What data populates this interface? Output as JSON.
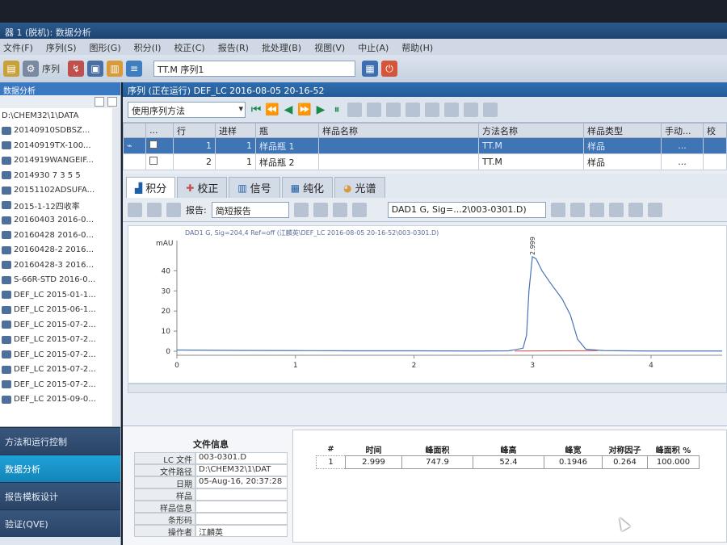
{
  "window": {
    "title": "器 1 (脱机): 数据分析"
  },
  "menu": [
    "文件(F)",
    "序列(S)",
    "图形(G)",
    "积分(I)",
    "校正(C)",
    "报告(R)",
    "批处理(B)",
    "视图(V)",
    "中止(A)",
    "帮助(H)"
  ],
  "toolbar": {
    "run_label": "序列",
    "sequence_value": "TT.M 序列1"
  },
  "left_panel": {
    "header": "数据分析",
    "tree": [
      "D:\\CHEM32\\1\\DATA",
      "20140910SDBSZ...",
      "20140919TX-100...",
      "2014919WANGEIF...",
      "2014930 7 3 5 5",
      "20151102ADSUFA...",
      "2015-1-12四收率",
      "20160403 2016-0...",
      "20160428 2016-0...",
      "20160428-2 2016...",
      "20160428-3 2016...",
      "S-66R-STD 2016-0...",
      "DEF_LC 2015-01-1...",
      "DEF_LC 2015-06-1...",
      "DEF_LC 2015-07-2...",
      "DEF_LC 2015-07-2...",
      "DEF_LC 2015-07-2...",
      "DEF_LC 2015-07-2...",
      "DEF_LC 2015-07-2...",
      "DEF_LC 2015-09-0..."
    ],
    "nav": [
      "方法和运行控制",
      "数据分析",
      "报告模板设计",
      "验证(QVE)"
    ]
  },
  "sequence_bar": "序列 (正在运行) DEF_LC 2016-08-05 20-16-52",
  "method_select": "使用序列方法",
  "sequence_table": {
    "headers": [
      "...",
      "行",
      "进样",
      "瓶",
      "样品名称",
      "方法名称",
      "样品类型",
      "手动...",
      "校"
    ],
    "rows": [
      {
        "row": "1",
        "inj": "1",
        "vial": "样品瓶 1",
        "sample": "",
        "method": "TT.M",
        "type": "样品",
        "manual": "...",
        "calib": ""
      },
      {
        "row": "2",
        "inj": "1",
        "vial": "样品瓶 2",
        "sample": "",
        "method": "TT.M",
        "type": "样品",
        "manual": "...",
        "calib": ""
      }
    ]
  },
  "tabs": [
    "积分",
    "校正",
    "信号",
    "纯化",
    "光谱"
  ],
  "report": {
    "label": "报告:",
    "value": "简短报告",
    "signal": "DAD1 G, Sig=...2\\003-0301.D)"
  },
  "chart_data": {
    "type": "line",
    "title": "DAD1 G, Sig=204,4 Ref=off (江麟英\\DEF_LC 2016-08-05 20-16-52\\003-0301.D)",
    "ylabel": "mAU",
    "xlabel": "",
    "xlim": [
      0,
      4.6
    ],
    "ylim": [
      -2,
      55
    ],
    "xticks": [
      0,
      1,
      2,
      3,
      4
    ],
    "yticks": [
      0,
      10,
      20,
      30,
      40
    ],
    "peak_label": "2.999",
    "series": [
      {
        "color": "#4a73b8",
        "x": [
          0,
          0.5,
          1.0,
          1.5,
          2.0,
          2.5,
          2.8,
          2.92,
          2.95,
          2.97,
          2.999,
          3.03,
          3.08,
          3.15,
          3.25,
          3.32,
          3.38,
          3.45,
          3.6,
          4.0,
          4.6
        ],
        "y": [
          0.6,
          0.4,
          0.3,
          0.2,
          0.2,
          0.1,
          0.2,
          1.5,
          8,
          30,
          47,
          46,
          40,
          34,
          26,
          18,
          6,
          1,
          0.3,
          0.1,
          0.1
        ]
      }
    ],
    "baseline": {
      "color": "#c44",
      "x": [
        2.85,
        3.55
      ],
      "y": [
        0.1,
        0.3
      ]
    }
  },
  "file_info": {
    "title": "文件信息",
    "rows": [
      {
        "key": "LC 文件",
        "value": "003-0301.D"
      },
      {
        "key": "文件路径",
        "value": "D:\\CHEM32\\1\\DAT"
      },
      {
        "key": "日期",
        "value": "05-Aug-16, 20:37:28"
      },
      {
        "key": "样品",
        "value": ""
      },
      {
        "key": "样品信息",
        "value": ""
      },
      {
        "key": "条形码",
        "value": ""
      },
      {
        "key": "操作者",
        "value": "江麟英"
      }
    ]
  },
  "peak_table": {
    "headers": [
      "#",
      "时间",
      "峰面积",
      "峰高",
      "峰宽",
      "对称因子",
      "峰面积 %"
    ],
    "rows": [
      {
        "num": "1",
        "time": "2.999",
        "area": "747.9",
        "height": "52.4",
        "width": "0.1946",
        "symmetry": "0.264",
        "area_pct": "100.000"
      }
    ]
  }
}
